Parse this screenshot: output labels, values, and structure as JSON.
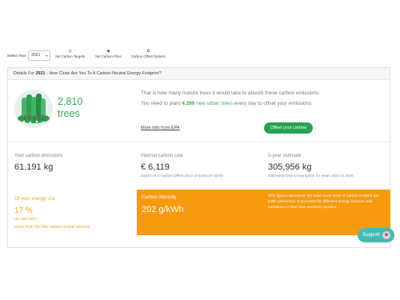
{
  "toolbar": {
    "select_year_label": "Select Year",
    "year_value": "2021",
    "carbon_targets_label": "Set Carbon Targets",
    "carbon_price_label": "Set Carbon Price",
    "offset_options_label": "Carbon Offset Options"
  },
  "panel": {
    "header_prefix": "Details For ",
    "header_year": "2021",
    "header_suffix": " - How Close Are You To A Carbon-Neutral Energy Footprint?"
  },
  "trees": {
    "count": "2,810",
    "word": "trees",
    "absorb_text": "That is how many mature trees it would take to absorb these carbon emissions.",
    "plant_prefix": "You need to plant ",
    "plant_number": "4.299",
    "plant_green": " new urban trees",
    "plant_suffix": " every day to offset your emissions.",
    "epa_link": "More Info from EPA",
    "offset_button": "Offset your carbon"
  },
  "stats": {
    "emissions_label": "Your carbon emissions",
    "emissions_value": "61,191 kg",
    "internal_cost_label": "Internal carbon cost",
    "internal_cost_value": "€ 6,119",
    "internal_cost_note": "based on a Carbon Offset price of €100 per tonne",
    "estimate_label": "5-year estimate",
    "estimate_value": "305,956 kg",
    "estimate_note": "estimated total consumption for years 2021 to 2026"
  },
  "energy": {
    "label": "Of your energy use",
    "percent": "17 %",
    "kwh": "(50,488 kWh)",
    "source": "came from On-Site carbon neutral sources"
  },
  "intensity": {
    "label": "Carbon intensity",
    "value": "202 g/kWh",
    "description": "This figure represents the total mean level of carbon emitted per kWh consumed. It accounts for different energy sources and variations in their own emission profiles."
  },
  "support": {
    "label": "Support"
  },
  "colors": {
    "green": "#3ba957",
    "button_green": "#2aa150",
    "orange": "#f79a10",
    "orange_text": "#f5a623",
    "support_teal": "#43bdb4"
  }
}
